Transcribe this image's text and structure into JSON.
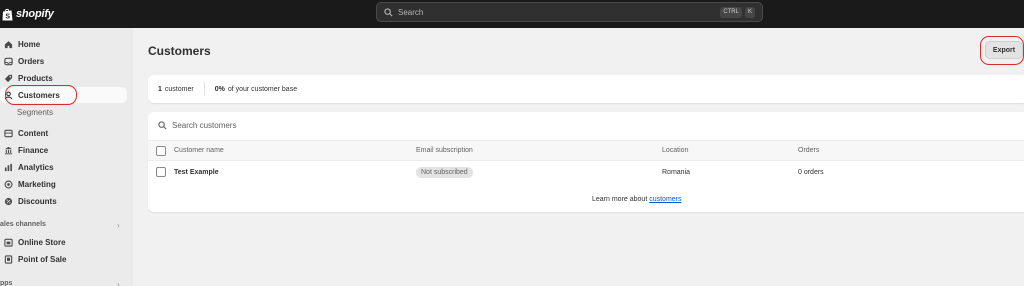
{
  "topbar": {
    "logo_text": "shopify",
    "search_placeholder": "Search",
    "shortcut_keys": [
      "CTRL",
      "K"
    ]
  },
  "sidebar": {
    "items": [
      {
        "label": "Home",
        "icon": "home-icon"
      },
      {
        "label": "Orders",
        "icon": "inbox-icon"
      },
      {
        "label": "Products",
        "icon": "tag-icon"
      },
      {
        "label": "Customers",
        "icon": "person-icon",
        "active": true
      },
      {
        "label": "Segments",
        "sub": true
      },
      {
        "label": "Content",
        "icon": "content-icon"
      },
      {
        "label": "Finance",
        "icon": "bank-icon"
      },
      {
        "label": "Analytics",
        "icon": "bar-chart-icon"
      },
      {
        "label": "Marketing",
        "icon": "target-icon"
      },
      {
        "label": "Discounts",
        "icon": "discount-icon"
      }
    ],
    "sales_channels_label": "ales channels",
    "channels": [
      {
        "label": "Online Store",
        "icon": "store-icon"
      },
      {
        "label": "Point of Sale",
        "icon": "pos-icon"
      }
    ],
    "apps_label": "pps"
  },
  "main": {
    "title": "Customers",
    "export_label": "Export",
    "stats": [
      {
        "value": "1",
        "label": "customer"
      },
      {
        "value": "0%",
        "label": "of your customer base"
      }
    ],
    "table": {
      "search_placeholder": "Search customers",
      "columns": [
        "Customer name",
        "Email subscription",
        "Location",
        "Orders"
      ],
      "rows": [
        {
          "name": "Test Example",
          "subscription": "Not subscribed",
          "location": "Romania",
          "orders": "0 orders"
        }
      ]
    },
    "learn_more_prefix": "Learn more about",
    "learn_more_link": "customers"
  },
  "colors": {
    "topbar_bg": "#1a1a1a",
    "highlight_ring": "#d82c2c",
    "link": "#005bd3"
  }
}
